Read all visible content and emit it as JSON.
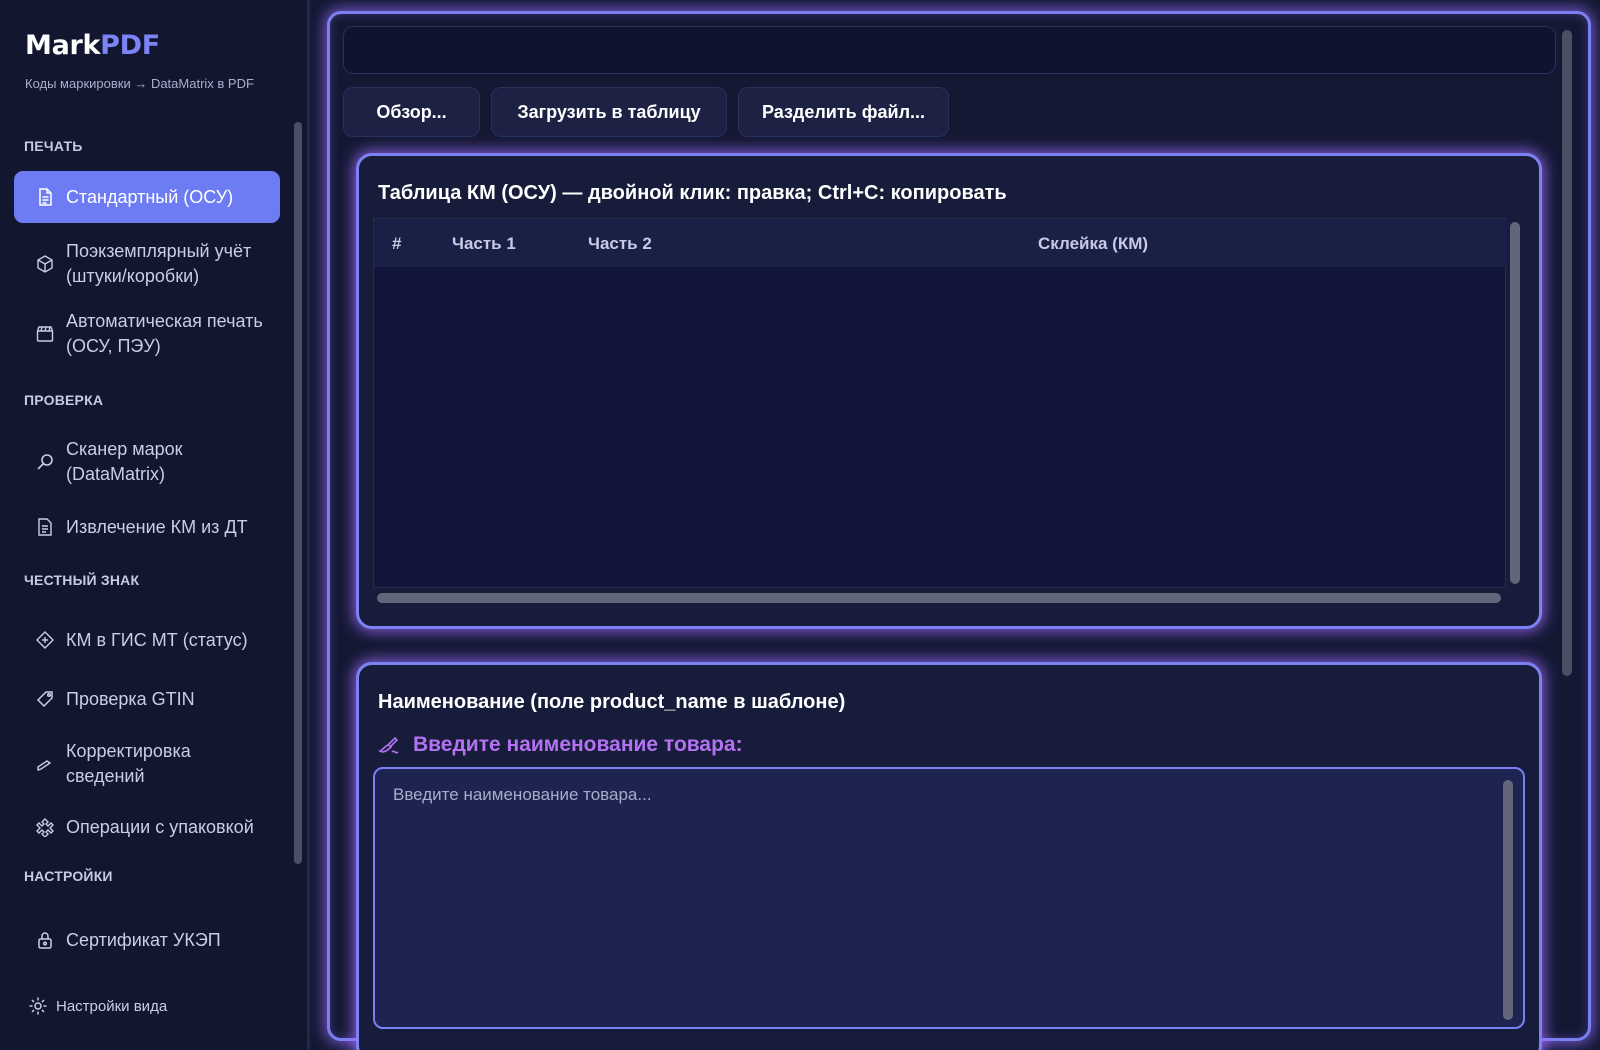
{
  "app": {
    "brand_main": "Mark",
    "brand_accent": "PDF",
    "tagline": "Коды маркировки → DataMatrix в PDF"
  },
  "sidebar": {
    "sections": [
      {
        "title": "ПЕЧАТЬ"
      },
      {
        "title": "ПРОВЕРКА"
      },
      {
        "title": "ЧЕСТНЫЙ ЗНАК"
      },
      {
        "title": "НАСТРОЙКИ"
      }
    ],
    "items": [
      {
        "label": "Стандартный (ОСУ)",
        "icon": "document-icon",
        "active": true
      },
      {
        "label": "Поэкземплярный учёт (штуки/коробки)",
        "icon": "package-icon"
      },
      {
        "label": "Автоматическая печать (ОСУ, ПЭУ)",
        "icon": "clapper-icon"
      },
      {
        "label": "Сканер марок (DataMatrix)",
        "icon": "magnifier-icon"
      },
      {
        "label": "Извлечение КМ из ДТ",
        "icon": "extract-document-icon"
      },
      {
        "label": "КМ в ГИС МТ (статус)",
        "icon": "status-tag-icon"
      },
      {
        "label": "Проверка GTIN",
        "icon": "tag-icon"
      },
      {
        "label": "Корректировка сведений",
        "icon": "pencil-icon"
      },
      {
        "label": "Операции с упаковкой",
        "icon": "puzzle-icon"
      },
      {
        "label": "Сертификат УКЭП",
        "icon": "lock-icon"
      }
    ],
    "settings_link": "Настройки вида"
  },
  "toolbar": {
    "path_value": "",
    "browse_label": "Обзор...",
    "load_label": "Загрузить в таблицу",
    "split_label": "Разделить файл..."
  },
  "km_table": {
    "title": "Таблица КМ (ОСУ) — двойной клик: правка; Ctrl+C: копировать",
    "columns": [
      "#",
      "Часть 1",
      "Часть 2",
      "Склейка (КМ)"
    ],
    "rows": []
  },
  "name_panel": {
    "title": "Наименование (поле product_name в шаблоне)",
    "prompt": "Введите наименование товара:",
    "placeholder": "Введите наименование товара...",
    "value": ""
  },
  "colors": {
    "accent": "#6e7cf4",
    "prompt": "#b372f2",
    "glow_border": "#7a80f2"
  }
}
